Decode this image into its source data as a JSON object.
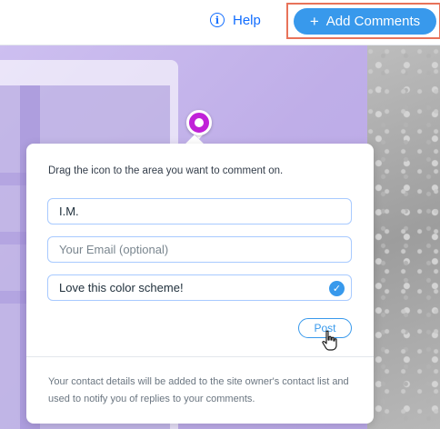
{
  "toolbar": {
    "help_label": "Help",
    "help_icon": "info-circle-icon",
    "add_comments_label": "Add Comments",
    "add_icon": "plus-icon"
  },
  "comment_form": {
    "instruction": "Drag the icon to the area you want to comment on.",
    "name_value": "I.M.",
    "email_placeholder": "Your Email (optional)",
    "comment_value": "Love this color scheme!",
    "post_label": "Post",
    "contact_note": "Your contact details will be added to the site owner's contact list and used to notify you of replies to your comments."
  },
  "colors": {
    "accent": "#3899ec",
    "pin": "#c021d8",
    "highlight_frame": "#e8735a"
  }
}
